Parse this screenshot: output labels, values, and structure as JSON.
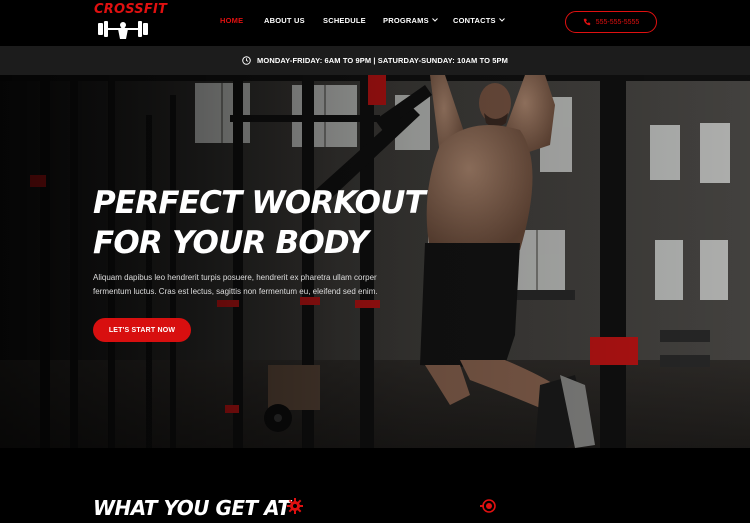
{
  "brand": {
    "logo_text": "CROSSFIT"
  },
  "nav": {
    "items": [
      {
        "label": "HOME",
        "active": true,
        "dropdown": false
      },
      {
        "label": "ABOUT US",
        "active": false,
        "dropdown": false
      },
      {
        "label": "SCHEDULE",
        "active": false,
        "dropdown": false
      },
      {
        "label": "PROGRAMS",
        "active": false,
        "dropdown": true
      },
      {
        "label": "CONTACTS",
        "active": false,
        "dropdown": true
      }
    ],
    "phone": "555-555-5555"
  },
  "schedule": {
    "text": "MONDAY-FRIDAY: 6AM TO 9PM | SATURDAY-SUNDAY: 10AM TO 5PM",
    "icon": "clock-icon"
  },
  "hero": {
    "title_line1": "PERFECT WORKOUT",
    "title_line2": "FOR YOUR BODY",
    "text": "Aliquam dapibus leo hendrerit turpis posuere, hendrerit ex pharetra ullam corper fermentum luctus. Cras est lectus, sagittis non fermentum eu, eleifend sed enim.",
    "cta_label": "LET'S START NOW"
  },
  "section": {
    "title": "WHAT YOU GET AT"
  },
  "colors": {
    "accent": "#e01010",
    "background": "#000000",
    "bar": "#1c1c1c"
  }
}
